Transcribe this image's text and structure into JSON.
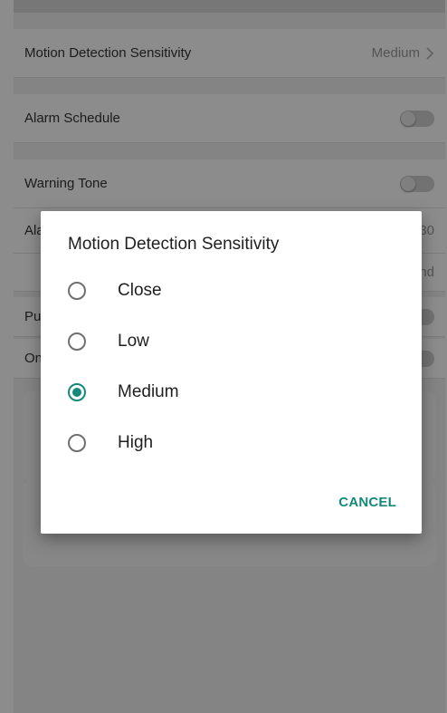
{
  "background_settings": {
    "rows": [
      {
        "label": "Motion Detection Sensitivity",
        "value": "Medium",
        "type": "value"
      },
      {
        "label": "Alarm Schedule",
        "type": "toggle"
      },
      {
        "label": "Warning Tone",
        "type": "toggle"
      },
      {
        "label": "Ala",
        "trailing": "30",
        "type": "partial"
      },
      {
        "label": "",
        "trailing": "nd",
        "type": "partial"
      },
      {
        "label": "Pu",
        "type": "partial-toggle"
      },
      {
        "label": "On",
        "type": "partial-toggle"
      }
    ]
  },
  "dialog": {
    "title": "Motion Detection Sensitivity",
    "options": [
      {
        "label": "Close",
        "selected": false
      },
      {
        "label": "Low",
        "selected": false
      },
      {
        "label": "Medium",
        "selected": true
      },
      {
        "label": "High",
        "selected": false
      }
    ],
    "cancel_label": "CANCEL"
  },
  "icons": {
    "chevron": "chevron-right-icon",
    "radio_unchecked": "radio-unchecked-icon",
    "radio_checked": "radio-checked-icon"
  },
  "colors": {
    "accent": "#15897a",
    "overlay": "rgba(0,0,0,0.45)"
  }
}
